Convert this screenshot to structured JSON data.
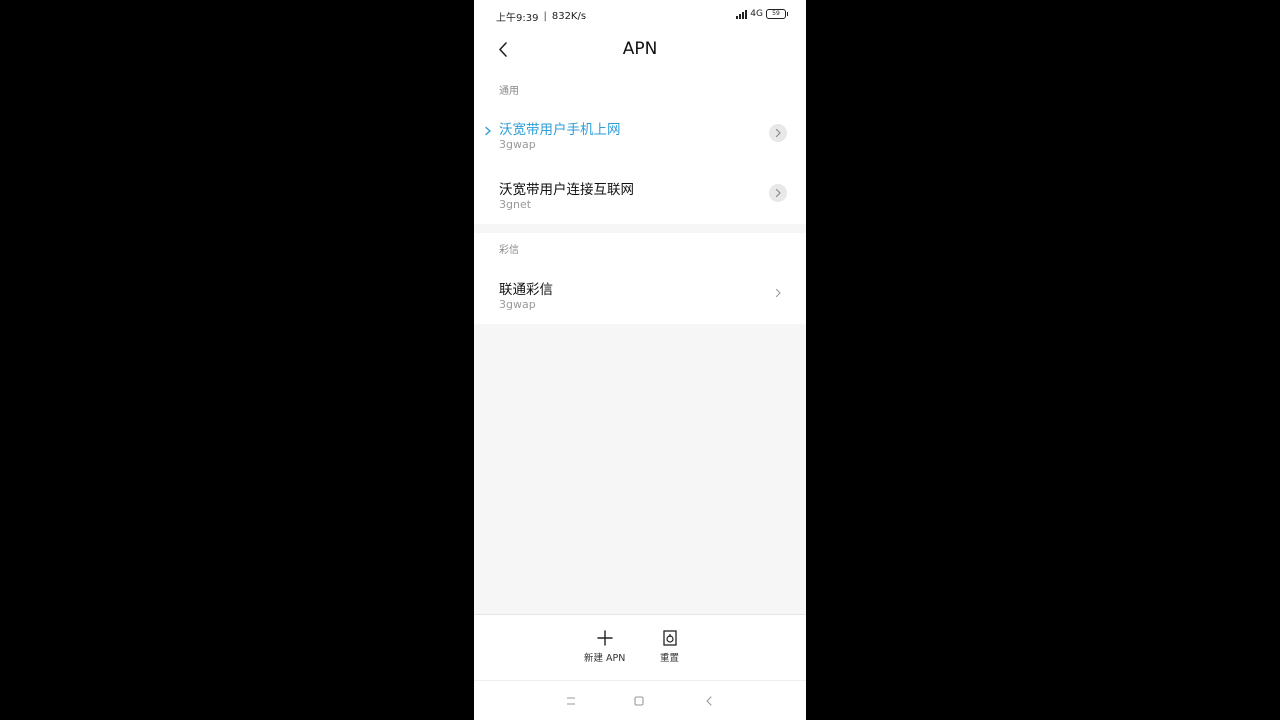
{
  "status_bar": {
    "time": "上午9:39",
    "speed": "832K/s",
    "network": "4G",
    "battery": "59"
  },
  "header": {
    "title": "APN"
  },
  "sections": [
    {
      "header": "通用",
      "items": [
        {
          "name": "沃宽带用户手机上网",
          "apn": "3gwap",
          "selected": true
        },
        {
          "name": "沃宽带用户连接互联网",
          "apn": "3gnet",
          "selected": false
        }
      ]
    },
    {
      "header": "彩信",
      "items": [
        {
          "name": "联通彩信",
          "apn": "3gwap",
          "selected": false
        }
      ]
    }
  ],
  "toolbar": {
    "new_apn_label": "新建 APN",
    "reset_label": "重置"
  },
  "colors": {
    "accent": "#2f9ed8",
    "background": "#f5f6f5"
  }
}
